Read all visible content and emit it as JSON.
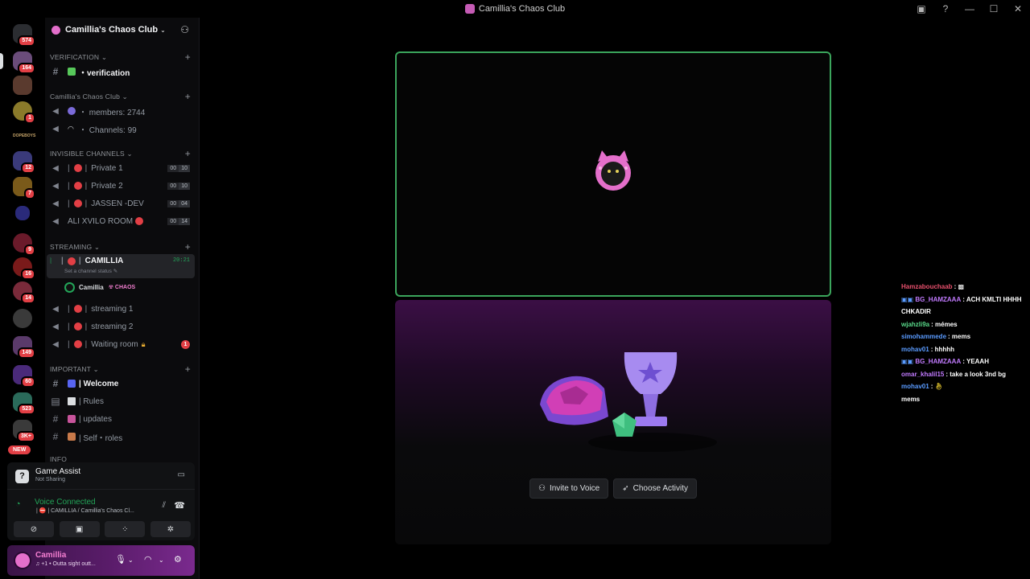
{
  "window": {
    "title": "Camillia's Chaos Club"
  },
  "rail": {
    "badges": [
      "574",
      "164",
      "1",
      "12",
      "7",
      "9",
      "16",
      "14",
      "149",
      "60",
      "523",
      "3K+"
    ],
    "new_label": "NEW",
    "text_server": "DOPEBOYS"
  },
  "guild": {
    "name": "Camillia's Chaos Club"
  },
  "categories": {
    "verification": "VERIFICATION",
    "club": "Camillia's Chaos Club",
    "invisible": "INVISIBLE CHANNELS",
    "streaming": "STREAMING",
    "important": "IMPORTANT",
    "info": "INFO"
  },
  "channels": {
    "verification": "・verification",
    "members": "・ members: 2744",
    "chcount": "・ Channels: 99",
    "private1": "Private 1",
    "private2": "Private 2",
    "jassen": "JASSEN -DEV",
    "ali": "ALI XVILO ROOM",
    "camillia": "CAMILLIA",
    "camillia_time": "20:21",
    "camillia_status": "Set a channel status",
    "streaming1": "streaming 1",
    "streaming2": "streaming 2",
    "waiting": "Waiting room",
    "waiting_mention": "1",
    "welcome": "| Welcome",
    "rules": "| Rules",
    "updates": "| updates",
    "roles": "| Self・roles",
    "counts": {
      "p1": [
        "00",
        "10"
      ],
      "p2": [
        "00",
        "10"
      ],
      "jassen": [
        "00",
        "04"
      ],
      "ali": [
        "00",
        "14"
      ]
    }
  },
  "voice_user": {
    "name": "Camillia",
    "tag": "CHAOS"
  },
  "game_assist": {
    "title": "Game Assist",
    "subtitle": "Not Sharing"
  },
  "voice_connected": {
    "title": "Voice Connected",
    "channel": "| ⛔ | CAMILLIA / Camillia's Chaos Cl..."
  },
  "user": {
    "name": "Camillia",
    "status": "♫ +1 • Outta sight outt..."
  },
  "activity": {
    "invite_label": "Invite to Voice",
    "choose_label": "Choose Activity"
  },
  "chat_overlay": [
    {
      "user": "Hamzabouchaab",
      "text": "",
      "color": "#e8506d"
    },
    {
      "user": "BG_HAMZAAA",
      "text": "ACH KMLTI HHHH",
      "color": "#c27bff"
    },
    {
      "user": "",
      "text": "CHKADIR",
      "color": "#ffffff"
    },
    {
      "user": "wjahzli9a",
      "text": "mémes",
      "color": "#59d98a"
    },
    {
      "user": "simohammede",
      "text": "mems",
      "color": "#5a9bff"
    },
    {
      "user": "mohav01",
      "text": "hhhhh",
      "color": "#5a9bff"
    },
    {
      "user": "BG_HAMZAAA",
      "text": "YEAAH",
      "color": "#c27bff"
    },
    {
      "user": "omar_khalil15",
      "text": "take a look 3nd bg",
      "color": "#c27bff"
    },
    {
      "user": "mohav01",
      "text": "",
      "color": "#5a9bff"
    },
    {
      "user": "",
      "text": "mems",
      "color": "#ffffff"
    }
  ],
  "colors": {
    "accent_green": "#3ba55c",
    "mention_red": "#e23f45",
    "brand_pink": "#e46fcb"
  }
}
